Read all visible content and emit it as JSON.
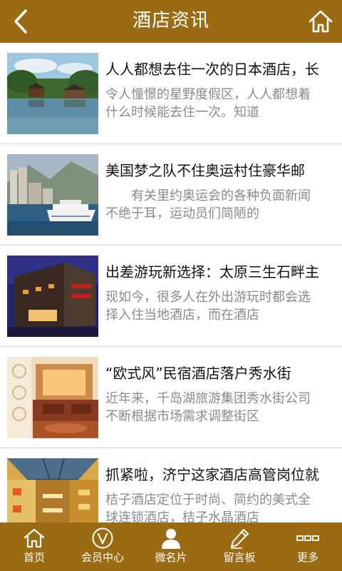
{
  "header": {
    "title": "酒店资讯",
    "back_icon": "chevron-left-icon",
    "home_icon": "home-icon",
    "bar_color": "#9a6b12"
  },
  "articles": [
    {
      "title": "人人都想去住一次的日本酒店，长",
      "summary": "令人憧憬的星野度假区，人人都想着什么时候能去住一次。知道",
      "image": "lakeside-resort-photo"
    },
    {
      "title": "美国梦之队不住奥运村住豪华邮",
      "summary": "　　有关里约奥运会的各种负面新闻不绝于耳，运动员们简陋的",
      "image": "cruise-ship-harbor-photo"
    },
    {
      "title": "出差游玩新选择：太原三生石畔主",
      "summary": "现如今，很多人在外出游玩时都会选择入住当地酒店，而在酒店",
      "image": "hotel-building-night-photo"
    },
    {
      "title": "“欧式风”民宿酒店落户秀水街",
      "summary": "近年来，千岛湖旅游集团秀水街公司不断根据市场需求调整街区",
      "image": "european-lobby-photo"
    },
    {
      "title": "抓紧啦，济宁这家酒店高管岗位就",
      "summary": "桔子酒店定位于时尚、简约的美式全球连锁酒店，桔子水晶酒店",
      "image": "hotel-atrium-photo"
    }
  ],
  "tabbar": {
    "items": [
      {
        "label": "首页",
        "icon": "home-icon"
      },
      {
        "label": "会员中心",
        "icon": "vip-circle-icon"
      },
      {
        "label": "微名片",
        "icon": "user-icon"
      },
      {
        "label": "留言板",
        "icon": "pen-icon"
      },
      {
        "label": "更多",
        "icon": "more-icon"
      }
    ]
  }
}
